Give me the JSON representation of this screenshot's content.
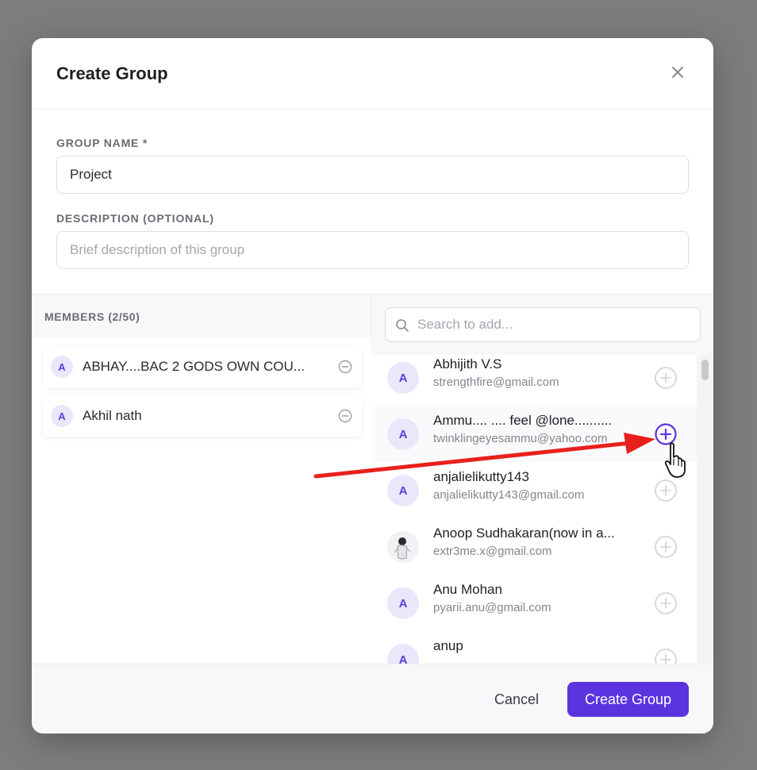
{
  "modal": {
    "title": "Create Group",
    "close_icon": "close-icon"
  },
  "form": {
    "group_name_label": "GROUP NAME *",
    "group_name_value": "Project",
    "description_label": "DESCRIPTION (OPTIONAL)",
    "description_placeholder": "Brief description of this group"
  },
  "members": {
    "title": "MEMBERS (2/50)",
    "items": [
      {
        "initial": "A",
        "name": "ABHAY....BAC 2 GODS OWN COU...",
        "remove_icon": "minus-circle-icon"
      },
      {
        "initial": "A",
        "name": "Akhil nath",
        "remove_icon": "minus-circle-icon"
      }
    ]
  },
  "search": {
    "placeholder": "Search to add...",
    "icon": "search-icon"
  },
  "results": [
    {
      "initial": "A",
      "name": "Abhijith V.S",
      "email": "strengthfire@gmail.com",
      "add_icon": "plus-circle-icon"
    },
    {
      "initial": "A",
      "name": "Ammu.... .... feel @lone..........",
      "email": "twinklingeyesammu@yahoo.com",
      "add_icon": "plus-circle-icon",
      "active": true
    },
    {
      "initial": "A",
      "name": "anjalielikutty143",
      "email": "anjalielikutty143@gmail.com",
      "add_icon": "plus-circle-icon"
    },
    {
      "initial": "",
      "name": "Anoop Sudhakaran(now in a...",
      "email": "extr3me.x@gmail.com",
      "add_icon": "plus-circle-icon",
      "photo": true
    },
    {
      "initial": "A",
      "name": "Anu Mohan",
      "email": "pyarii.anu@gmail.com",
      "add_icon": "plus-circle-icon"
    },
    {
      "initial": "A",
      "name": "anup",
      "email": "",
      "add_icon": "plus-circle-icon"
    }
  ],
  "footer": {
    "cancel_label": "Cancel",
    "create_label": "Create Group"
  },
  "colors": {
    "accent": "#5b34e0",
    "annotation_arrow": "#e8201c"
  }
}
